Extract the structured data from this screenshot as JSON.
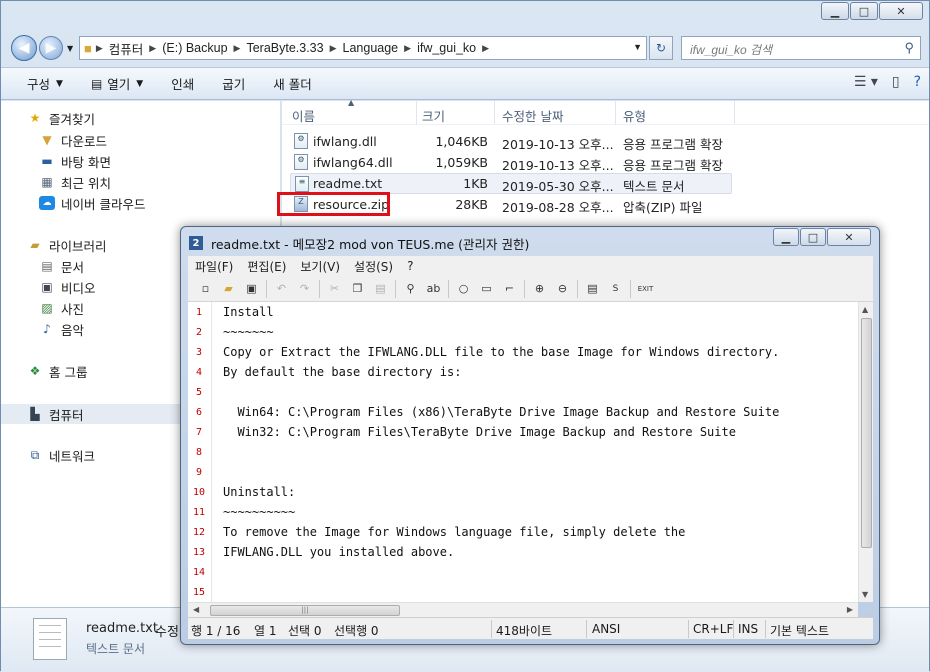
{
  "explorer": {
    "breadcrumb": [
      "컴퓨터",
      "(E:) Backup",
      "TeraByte.3.33",
      "Language",
      "ifw_gui_ko"
    ],
    "search_placeholder": "ifw_gui_ko 검색",
    "toolbar": {
      "organize": "구성",
      "open": "열기",
      "print": "인쇄",
      "burn": "굽기",
      "new_folder": "새 폴더"
    },
    "sidebar": {
      "favorites": "즐겨찾기",
      "favorites_items": [
        "다운로드",
        "바탕 화면",
        "최근 위치",
        "네이버 클라우드"
      ],
      "libraries": "라이브러리",
      "libraries_items": [
        "문서",
        "비디오",
        "사진",
        "음악"
      ],
      "homegroup": "홈 그룹",
      "computer": "컴퓨터",
      "network": "네트워크"
    },
    "columns": {
      "name": "이름",
      "size": "크기",
      "modified": "수정한 날짜",
      "type": "유형"
    },
    "files": [
      {
        "name": "ifwlang.dll",
        "size": "1,046KB",
        "date": "2019-10-13 오후...",
        "type": "응용 프로그램 확장"
      },
      {
        "name": "ifwlang64.dll",
        "size": "1,059KB",
        "date": "2019-10-13 오후...",
        "type": "응용 프로그램 확장"
      },
      {
        "name": "readme.txt",
        "size": "1KB",
        "date": "2019-05-30 오후...",
        "type": "텍스트 문서"
      },
      {
        "name": "resource.zip",
        "size": "28KB",
        "date": "2019-08-28 오후...",
        "type": "압축(ZIP) 파일"
      }
    ],
    "details": {
      "name": "readme.txt",
      "extra": "수정",
      "type": "텍스트 문서"
    }
  },
  "notepad": {
    "title": "readme.txt - 메모장2 mod von TEUS.me (관리자 권한)",
    "app_icon_text": "2",
    "menu": [
      "파일(F)",
      "편집(E)",
      "보기(V)",
      "설정(S)",
      "?"
    ],
    "lines": [
      {
        "n": "1",
        "text": "Install"
      },
      {
        "n": "2",
        "text": "~~~~~~~"
      },
      {
        "n": "3",
        "text": "Copy or Extract the IFWLANG.DLL file to the base Image for Windows directory."
      },
      {
        "n": "4",
        "text": "By default the base directory is:"
      },
      {
        "n": "5",
        "text": ""
      },
      {
        "n": "6",
        "text": "  Win64: C:\\Program Files (x86)\\TeraByte Drive Image Backup and Restore Suite"
      },
      {
        "n": "7",
        "text": "  Win32: C:\\Program Files\\TeraByte Drive Image Backup and Restore Suite"
      },
      {
        "n": "8",
        "text": ""
      },
      {
        "n": "9",
        "text": ""
      },
      {
        "n": "10",
        "text": "Uninstall:"
      },
      {
        "n": "11",
        "text": "~~~~~~~~~~"
      },
      {
        "n": "12",
        "text": "To remove the Image for Windows language file, simply delete the"
      },
      {
        "n": "13",
        "text": "IFWLANG.DLL you installed above."
      },
      {
        "n": "14",
        "text": ""
      },
      {
        "n": "15",
        "text": ""
      }
    ],
    "status": {
      "line": "행 1 / 16",
      "col": "열 1",
      "sel": "선택 0",
      "selline": "선택행 0",
      "size": "418바이트",
      "encoding": "ANSI",
      "eol": "CR+LF",
      "ins": "INS",
      "scheme": "기본 텍스트"
    }
  }
}
